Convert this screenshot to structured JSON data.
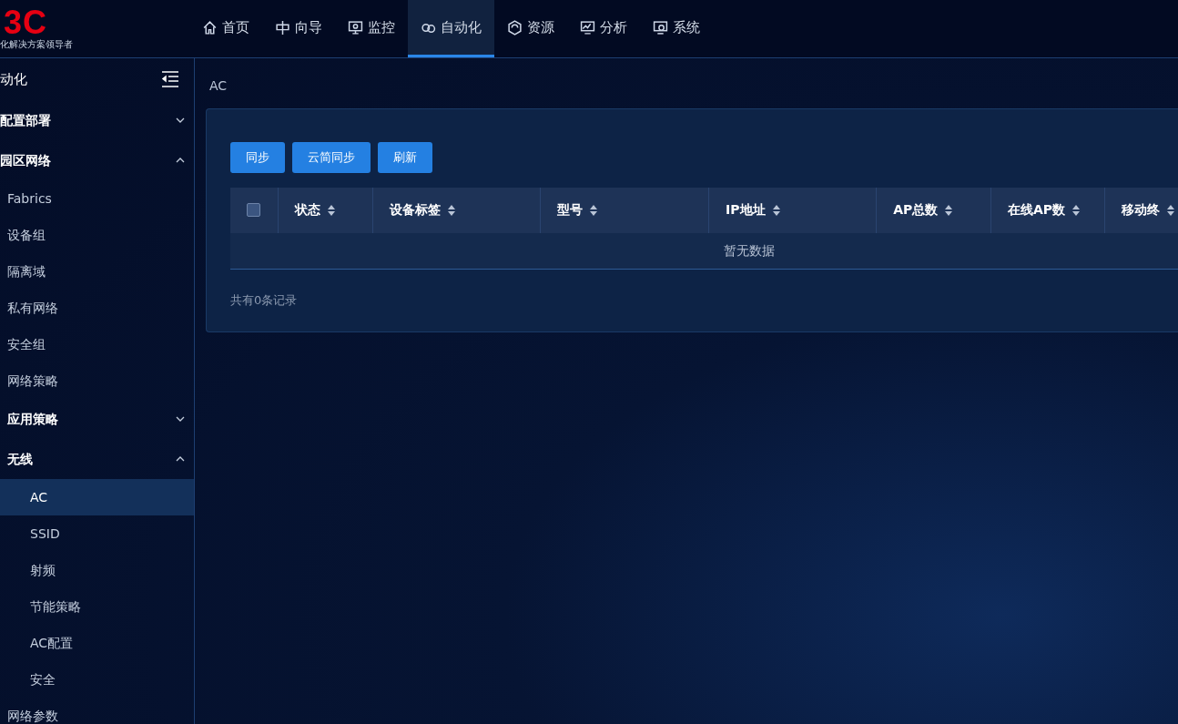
{
  "logo": {
    "mark": "3C",
    "tagline": "化解决方案领导者"
  },
  "nav": [
    {
      "label": "首页",
      "selected": false
    },
    {
      "label": "向导",
      "selected": false
    },
    {
      "label": "监控",
      "selected": false
    },
    {
      "label": "自动化",
      "selected": true
    },
    {
      "label": "资源",
      "selected": false
    },
    {
      "label": "分析",
      "selected": false
    },
    {
      "label": "系统",
      "selected": false
    }
  ],
  "sidebar": {
    "title": "动化",
    "items": [
      {
        "label": "配置部署",
        "kind": "group",
        "expanded": false
      },
      {
        "label": "园区网络",
        "kind": "group",
        "expanded": true,
        "children": [
          {
            "label": "Fabrics",
            "selected": false
          },
          {
            "label": "设备组",
            "selected": false
          },
          {
            "label": "隔离域",
            "selected": false
          },
          {
            "label": "私有网络",
            "selected": false
          },
          {
            "label": "安全组",
            "selected": false
          },
          {
            "label": "网络策略",
            "selected": false
          },
          {
            "label": "应用策略",
            "kind": "group",
            "expanded": false
          },
          {
            "label": "无线",
            "kind": "group",
            "expanded": true,
            "children": [
              {
                "label": "AC",
                "selected": true
              },
              {
                "label": "SSID",
                "selected": false
              },
              {
                "label": "射频",
                "selected": false
              },
              {
                "label": "节能策略",
                "selected": false
              },
              {
                "label": "AC配置",
                "selected": false
              },
              {
                "label": "安全",
                "selected": false
              }
            ]
          },
          {
            "label": "网络参数",
            "selected": false
          }
        ]
      }
    ]
  },
  "breadcrumb": "AC",
  "buttons": [
    "同步",
    "云简同步",
    "刷新"
  ],
  "table": {
    "select_all_checked": false,
    "columns": [
      "状态",
      "设备标签",
      "型号",
      "IP地址",
      "AP总数",
      "在线AP数",
      "移动终"
    ],
    "empty_text": "暂无数据"
  },
  "footer": "共有0条记录"
}
